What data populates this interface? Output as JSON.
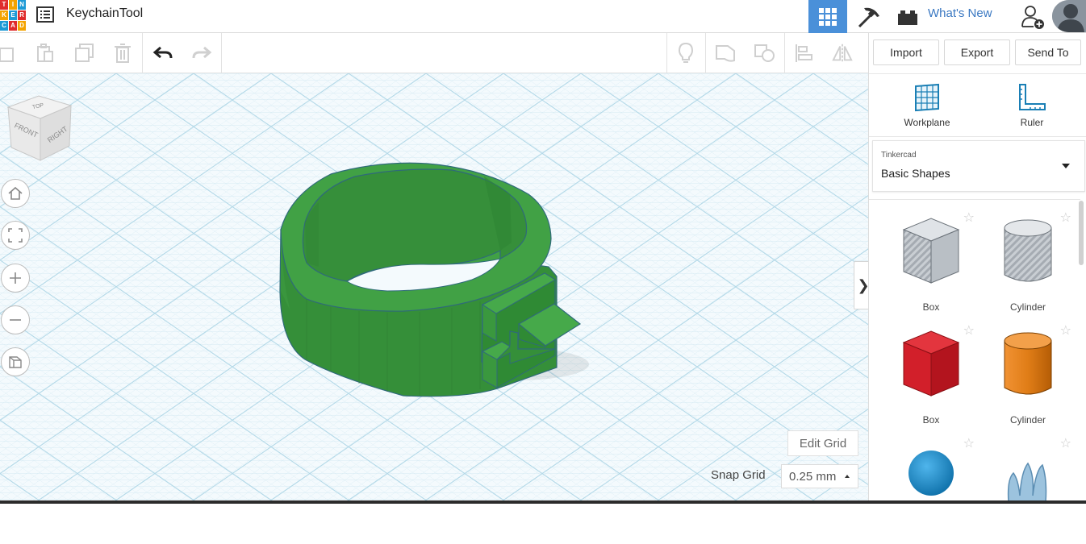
{
  "app": {
    "logo_letters": [
      "T",
      "I",
      "N",
      "K",
      "E",
      "R",
      "C",
      "A",
      "D"
    ],
    "document_title": "KeychainTool"
  },
  "topbar": {
    "whats_new_label": "What's New"
  },
  "toolbar": {
    "import_label": "Import",
    "export_label": "Export",
    "send_to_label": "Send To"
  },
  "right_panel": {
    "workplane_label": "Workplane",
    "ruler_label": "Ruler",
    "library": {
      "provider": "Tinkercad",
      "selected": "Basic Shapes"
    },
    "shapes": [
      {
        "label": "Box",
        "style": "hole",
        "icon": "box-hole-icon"
      },
      {
        "label": "Cylinder",
        "style": "hole",
        "icon": "cylinder-hole-icon"
      },
      {
        "label": "Box",
        "color": "#d2202a",
        "icon": "box-icon"
      },
      {
        "label": "Cylinder",
        "color": "#e07d17",
        "icon": "cylinder-icon"
      },
      {
        "label": "",
        "color": "#1a8fd3",
        "icon": "sphere-icon"
      },
      {
        "label": "",
        "color": "#8fb8d6",
        "icon": "scribble-icon"
      }
    ]
  },
  "viewcube": {
    "top": "TOP",
    "front": "FRONT",
    "right": "RIGHT"
  },
  "workspace": {
    "edit_grid_label": "Edit Grid",
    "snap_grid_label": "Snap Grid",
    "snap_grid_value": "0.25 mm",
    "model_color": "#3b9a3f"
  },
  "colors": {
    "accent": "#4a90d9",
    "grid_line": "#bfe2ef"
  }
}
